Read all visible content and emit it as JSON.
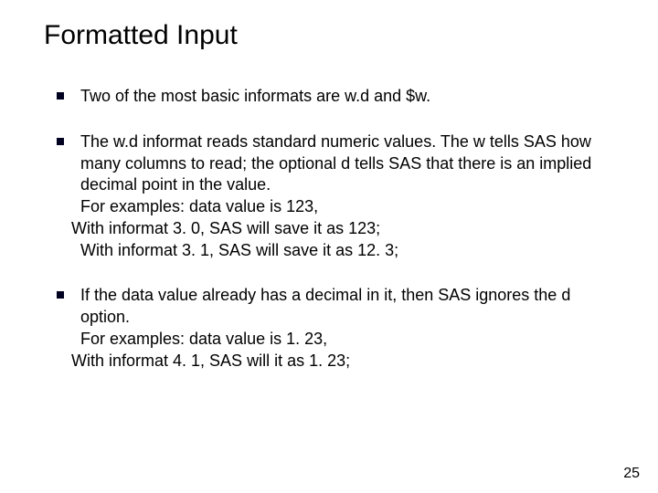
{
  "title": "Formatted Input",
  "bullets": {
    "b1": "Two of the most basic informats are w.d and $w.",
    "b2_l1": "The w.d informat reads standard numeric values. The w tells SAS how many columns to read; the optional d tells SAS that there is an implied decimal point in the value.",
    "b2_l2": "For examples: data value is 123,",
    "b2_l3": "With informat 3. 0, SAS will save it as 123;",
    "b2_l4": "With informat 3. 1, SAS will save it as 12. 3;",
    "b3_l1": "If the data value already has a decimal in it, then SAS ignores the d option.",
    "b3_l2": "For examples: data value is 1. 23,",
    "b3_l3": "With informat 4. 1, SAS will it as 1. 23;"
  },
  "page_number": "25"
}
